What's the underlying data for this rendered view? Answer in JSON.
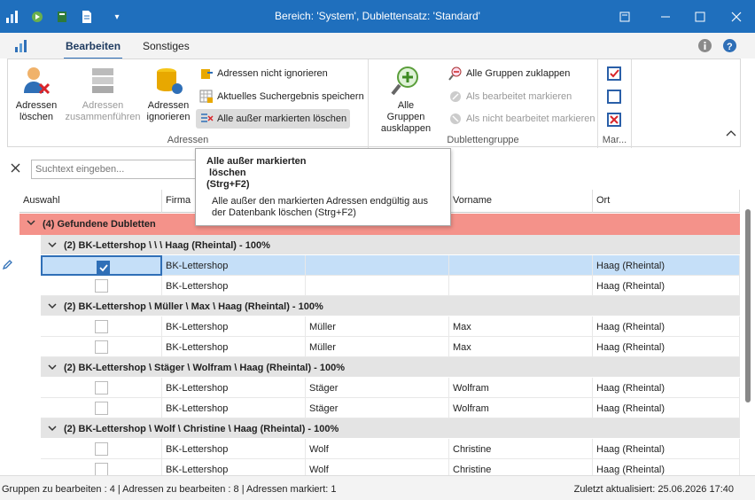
{
  "window": {
    "title": "Bereich: 'System', Dublettensatz: 'Standard'"
  },
  "qat": {
    "icons": [
      "app-chart-icon",
      "run-icon",
      "export-icon",
      "document-icon",
      "dropdown-icon"
    ]
  },
  "menu": {
    "tabs": [
      "Bearbeiten",
      "Sonstiges"
    ]
  },
  "ribbon": {
    "adressen": {
      "label": "Adressen",
      "btn_delete": "Adressen\nlöschen",
      "btn_merge": "Adressen\nzusammenführen",
      "btn_ignore": "Adressen\nignorieren",
      "sm_not_ignore": "Adressen nicht ignorieren",
      "sm_save": "Aktuelles Suchergebnis speichern",
      "sm_delete_except": "Alle außer markierten  löschen"
    },
    "dubletten": {
      "label": "Dublettengruppe",
      "btn_expand": "Alle Gruppen\nausklappen",
      "sm_collapse": "Alle Gruppen zuklappen",
      "sm_mark_edited": "Als bearbeitet markieren",
      "sm_mark_unedited": "Als nicht bearbeitet markieren"
    },
    "mark": {
      "label": "Mar..."
    }
  },
  "search": {
    "placeholder": "Suchtext eingeben..."
  },
  "tooltip": {
    "title": "Alle außer markierten\n löschen\n(Strg+F2)",
    "body": "Alle außer den markierten Adressen endgültig aus der Datenbank löschen (Strg+F2)"
  },
  "grid": {
    "headers": [
      "Auswahl",
      "Firma",
      "",
      "Vorname",
      "Ort"
    ],
    "top_group": "(4) Gefundene Dubletten",
    "groups": [
      {
        "label": "(2) BK-Lettershop \\  \\  \\ Haag (Rheintal) - 100%",
        "rows": [
          {
            "checked": true,
            "firma": "BK-Lettershop",
            "name": "",
            "vorname": "",
            "ort": "Haag (Rheintal)",
            "selected": true
          },
          {
            "checked": false,
            "firma": "BK-Lettershop",
            "name": "",
            "vorname": "",
            "ort": "Haag (Rheintal)"
          }
        ]
      },
      {
        "label": "(2) BK-Lettershop \\ Müller \\ Max \\ Haag (Rheintal) - 100%",
        "rows": [
          {
            "checked": false,
            "firma": "BK-Lettershop",
            "name": "Müller",
            "vorname": "Max",
            "ort": "Haag (Rheintal)"
          },
          {
            "checked": false,
            "firma": "BK-Lettershop",
            "name": "Müller",
            "vorname": "Max",
            "ort": "Haag (Rheintal)"
          }
        ]
      },
      {
        "label": "(2) BK-Lettershop \\ Stäger \\ Wolfram \\ Haag (Rheintal) - 100%",
        "rows": [
          {
            "checked": false,
            "firma": "BK-Lettershop",
            "name": "Stäger",
            "vorname": "Wolfram",
            "ort": "Haag (Rheintal)"
          },
          {
            "checked": false,
            "firma": "BK-Lettershop",
            "name": "Stäger",
            "vorname": "Wolfram",
            "ort": "Haag (Rheintal)"
          }
        ]
      },
      {
        "label": "(2) BK-Lettershop \\ Wolf \\ Christine \\ Haag (Rheintal) - 100%",
        "rows": [
          {
            "checked": false,
            "firma": "BK-Lettershop",
            "name": "Wolf",
            "vorname": "Christine",
            "ort": "Haag (Rheintal)"
          },
          {
            "checked": false,
            "firma": "BK-Lettershop",
            "name": "Wolf",
            "vorname": "Christine",
            "ort": "Haag (Rheintal)"
          }
        ]
      }
    ]
  },
  "status": {
    "left": "Gruppen zu bearbeiten : 4 | Adressen zu bearbeiten : 8 | Adressen markiert: 1",
    "right": "Zuletzt aktualisiert: 25.06.2026 17:40"
  },
  "colors": {
    "titlebar": "#1f6fbd",
    "top_group": "#f4928a",
    "group": "#e4e4e4",
    "selected": "#c5dff8"
  }
}
